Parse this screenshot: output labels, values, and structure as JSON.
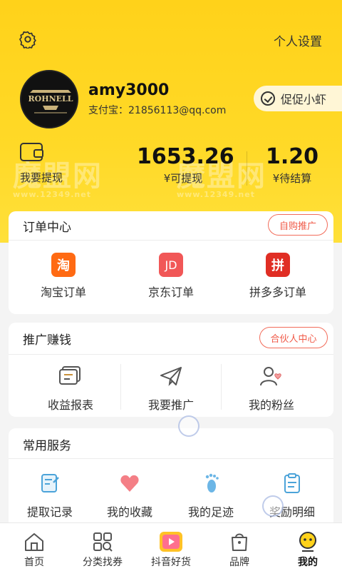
{
  "header": {
    "settings_label": "个人设置",
    "username": "amy3000",
    "alipay": "支付宝：21856113@qq.com",
    "promo_label": "促促小虾",
    "avatar_text": "ROHNELL",
    "watermark_main": "魔盟网",
    "watermark_sub": "www.12349.net"
  },
  "stats": {
    "withdraw_label": "我要提现",
    "available_value": "1653.26",
    "available_label": "¥可提现",
    "pending_value": "1.20",
    "pending_label": "¥待结算"
  },
  "orders": {
    "title": "订单中心",
    "badge": "自购推广",
    "items": [
      {
        "label": "淘宝订单",
        "glyph": "淘",
        "color": "#ff6a13"
      },
      {
        "label": "京东订单",
        "glyph": "JD",
        "color": "#ef4a4a"
      },
      {
        "label": "拼多多订单",
        "glyph": "拼",
        "color": "#e02e24"
      }
    ]
  },
  "promo": {
    "title": "推广赚钱",
    "badge": "合伙人中心",
    "items": [
      {
        "label": "收益报表",
        "icon": "report-icon"
      },
      {
        "label": "我要推广",
        "icon": "paper-plane-icon"
      },
      {
        "label": "我的粉丝",
        "icon": "fans-icon"
      }
    ]
  },
  "services": {
    "title": "常用服务",
    "items": [
      {
        "label": "提取记录",
        "icon": "record-icon"
      },
      {
        "label": "我的收藏",
        "icon": "heart-icon"
      },
      {
        "label": "我的足迹",
        "icon": "footprint-icon"
      },
      {
        "label": "奖励明细",
        "icon": "reward-list-icon"
      }
    ]
  },
  "tabs": [
    {
      "label": "首页",
      "icon": "home-icon"
    },
    {
      "label": "分类找券",
      "icon": "category-icon"
    },
    {
      "label": "抖音好货",
      "icon": "video-icon"
    },
    {
      "label": "品牌",
      "icon": "brand-bag-icon"
    },
    {
      "label": "我的",
      "icon": "profile-icon",
      "active": true
    }
  ],
  "colors": {
    "accent": "#ffd927",
    "badge_red": "#f05a48"
  }
}
